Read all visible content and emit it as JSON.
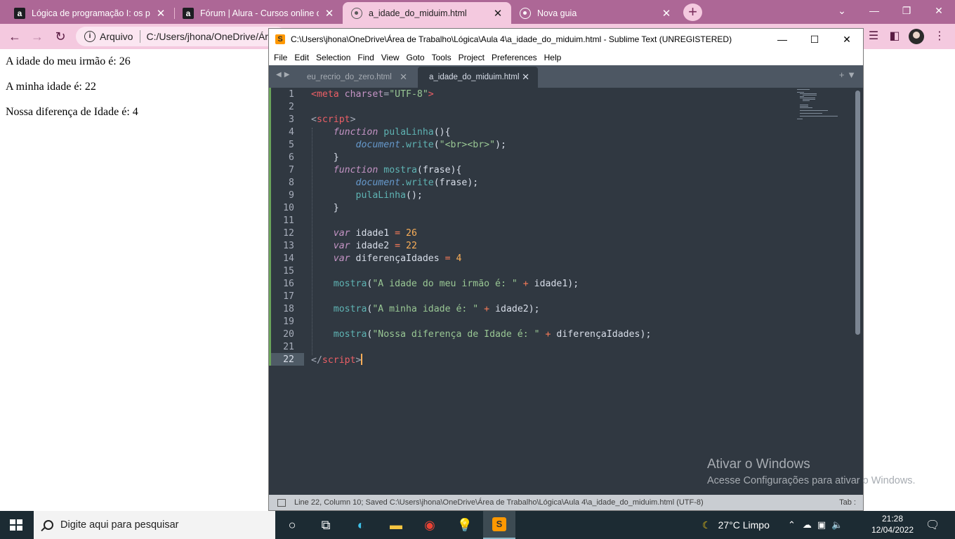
{
  "browser": {
    "tabs": [
      {
        "title": "Lógica de programação I: os prin",
        "favicon": "alura-icon"
      },
      {
        "title": "Fórum | Alura - Cursos online de",
        "favicon": "alura-icon"
      },
      {
        "title": "a_idade_do_miduim.html",
        "favicon": "globe-icon"
      },
      {
        "title": "Nova guia",
        "favicon": "chrome-icon"
      }
    ],
    "omnibox": {
      "security_label": "Arquivo",
      "url": "C:/Users/jhona/OneDrive/Ár"
    },
    "accent_color": "#ad6796"
  },
  "page": {
    "lines": [
      "A idade do meu irmão é: 26",
      "A minha idade é: 22",
      "Nossa diferença de Idade é: 4"
    ]
  },
  "sublime": {
    "title": "C:\\Users\\jhona\\OneDrive\\Área de Trabalho\\Lógica\\Aula 4\\a_idade_do_miduim.html - Sublime Text (UNREGISTERED)",
    "menu": [
      "File",
      "Edit",
      "Selection",
      "Find",
      "View",
      "Goto",
      "Tools",
      "Project",
      "Preferences",
      "Help"
    ],
    "tabs": [
      "eu_recrio_do_zero.html",
      "a_idade_do_miduim.html"
    ],
    "line_numbers": [
      "1",
      "2",
      "3",
      "4",
      "5",
      "6",
      "7",
      "8",
      "9",
      "10",
      "11",
      "12",
      "13",
      "14",
      "15",
      "16",
      "17",
      "18",
      "19",
      "20",
      "21",
      "22"
    ],
    "code": {
      "l1_tag_open": "<meta",
      "l1_attr": "charset",
      "l1_eq": "=",
      "l1_str": "\"UTF-8\"",
      "l1_close": ">",
      "l3_open": "<",
      "l3_tag": "script",
      "l3_close": ">",
      "kw_function": "function",
      "fn_pulaLinha": "pulaLinha",
      "parens_brace": "(){",
      "obj_document": "document",
      "dot_write": ".write",
      "l5_str": "\"<br><br>\"",
      "l5_end": ");",
      "brace_close": "}",
      "fn_mostra": "mostra",
      "l7_param": "(frase){",
      "l8_args": "(frase);",
      "l9_call": "pulaLinha",
      "l9_end": "();",
      "kw_var": "var",
      "v_idade1": "idade1",
      "v_idade2": "idade2",
      "v_dif": "diferençaIdades",
      "op_eq": "=",
      "op_plus": "+",
      "n_26": "26",
      "n_22": "22",
      "n_4": "4",
      "paren_open": "(",
      "s16": "\"A idade do meu irmão é: \"",
      "a16": "idade1);",
      "s18": "\"A minha idade é: \"",
      "a18": "idade2);",
      "s20": "\"Nossa diferença de Idade é: \"",
      "a20": "diferençaIdades);",
      "l22_open": "</",
      "l22_tag": "script",
      "l22_close": ">"
    },
    "status": "Line 22, Column 10; Saved C:\\Users\\jhona\\OneDrive\\Área de Trabalho\\Lógica\\Aula 4\\a_idade_do_miduim.html (UTF-8)",
    "tab_size": "Tab :"
  },
  "watermark": {
    "line1": "Ativar o Windows",
    "line2": "Acesse Configurações para ativar o Windows."
  },
  "taskbar": {
    "search_placeholder": "Digite aqui para pesquisar",
    "weather": "27°C  Limpo",
    "time": "21:28",
    "date": "12/04/2022"
  }
}
